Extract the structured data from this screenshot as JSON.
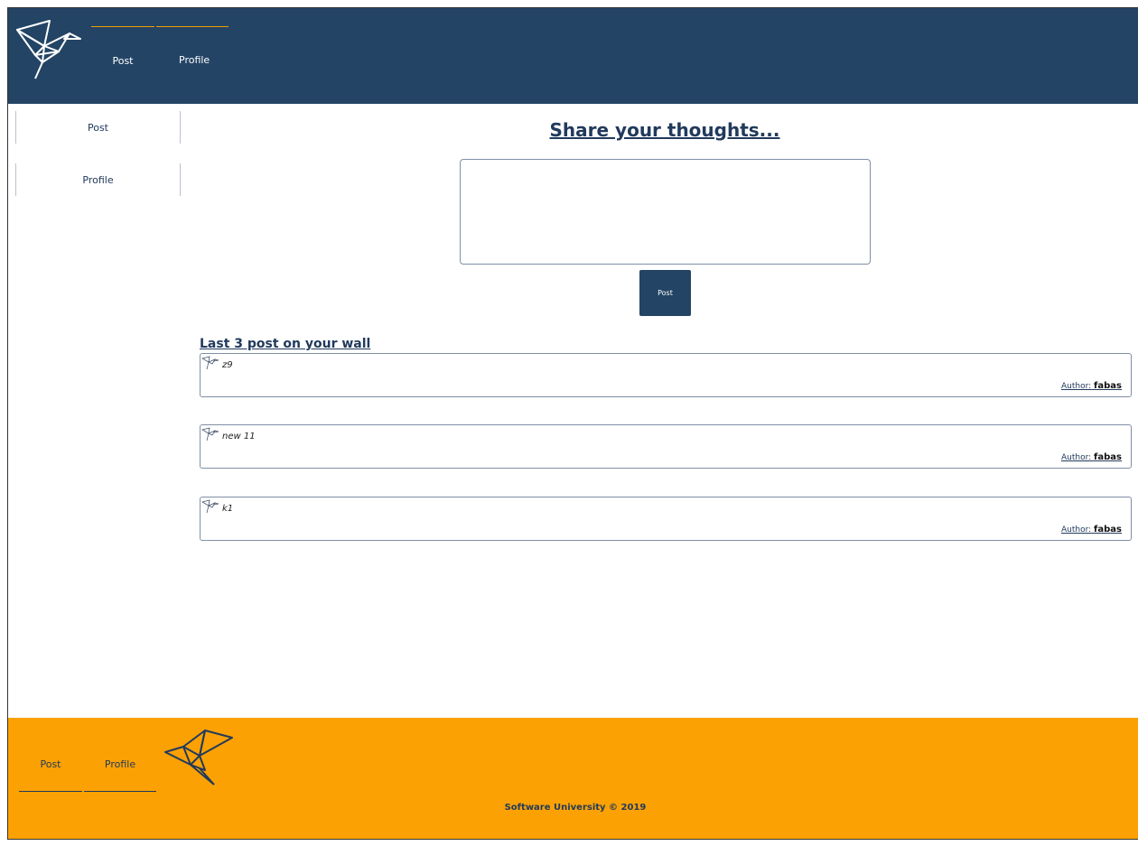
{
  "header": {
    "nav": [
      {
        "label": "Post"
      },
      {
        "label": "Profile"
      }
    ]
  },
  "sidebar": {
    "items": [
      {
        "label": "Post"
      },
      {
        "label": "Profile"
      }
    ]
  },
  "main": {
    "share_title": "Share your thoughts...",
    "thought_value": "",
    "post_button_label": "Post",
    "wall_title": "Last 3 post on your wall",
    "posts": [
      {
        "text": "z9",
        "author_label": "Author:",
        "author": "fabas"
      },
      {
        "text": "new 11",
        "author_label": "Author:",
        "author": "fabas"
      },
      {
        "text": "k1",
        "author_label": "Author:",
        "author": "fabas"
      }
    ]
  },
  "footer": {
    "nav": [
      {
        "label": "Post"
      },
      {
        "label": "Profile"
      }
    ],
    "copyright": "Software University © 2019"
  },
  "colors": {
    "header_bg": "#234465",
    "footer_bg": "#fca103",
    "accent": "#f59e00",
    "text": "#213a5c"
  },
  "icons": [
    "origami-bird-logo-icon",
    "origami-bird-icon"
  ]
}
